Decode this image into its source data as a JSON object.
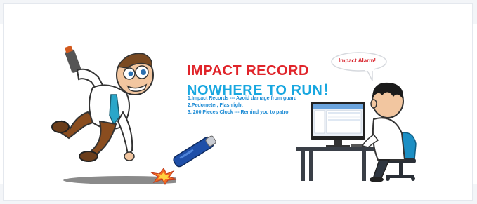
{
  "banner": {
    "headline_line1": "IMPACT  RECORD",
    "headline_line2": "NOWHERE TO RUN！",
    "features": [
      "1.Impact Records --- Avoid damage from guard",
      "2.Pedometer,  Flashlight",
      "3. 200 Pieces Clock --- Remind  you to patrol"
    ],
    "speech_bubble": "Impact Alarm!",
    "colors": {
      "headline_red": "#e0242a",
      "headline_blue": "#18a7e0",
      "feature_text": "#1d8bd4",
      "device_blue": "#1f4fa8"
    },
    "icons": [
      "running-man-illustration",
      "patrol-device-icon",
      "impact-spark-icon",
      "office-worker-illustration",
      "computer-monitor-icon",
      "office-chair-icon"
    ]
  }
}
